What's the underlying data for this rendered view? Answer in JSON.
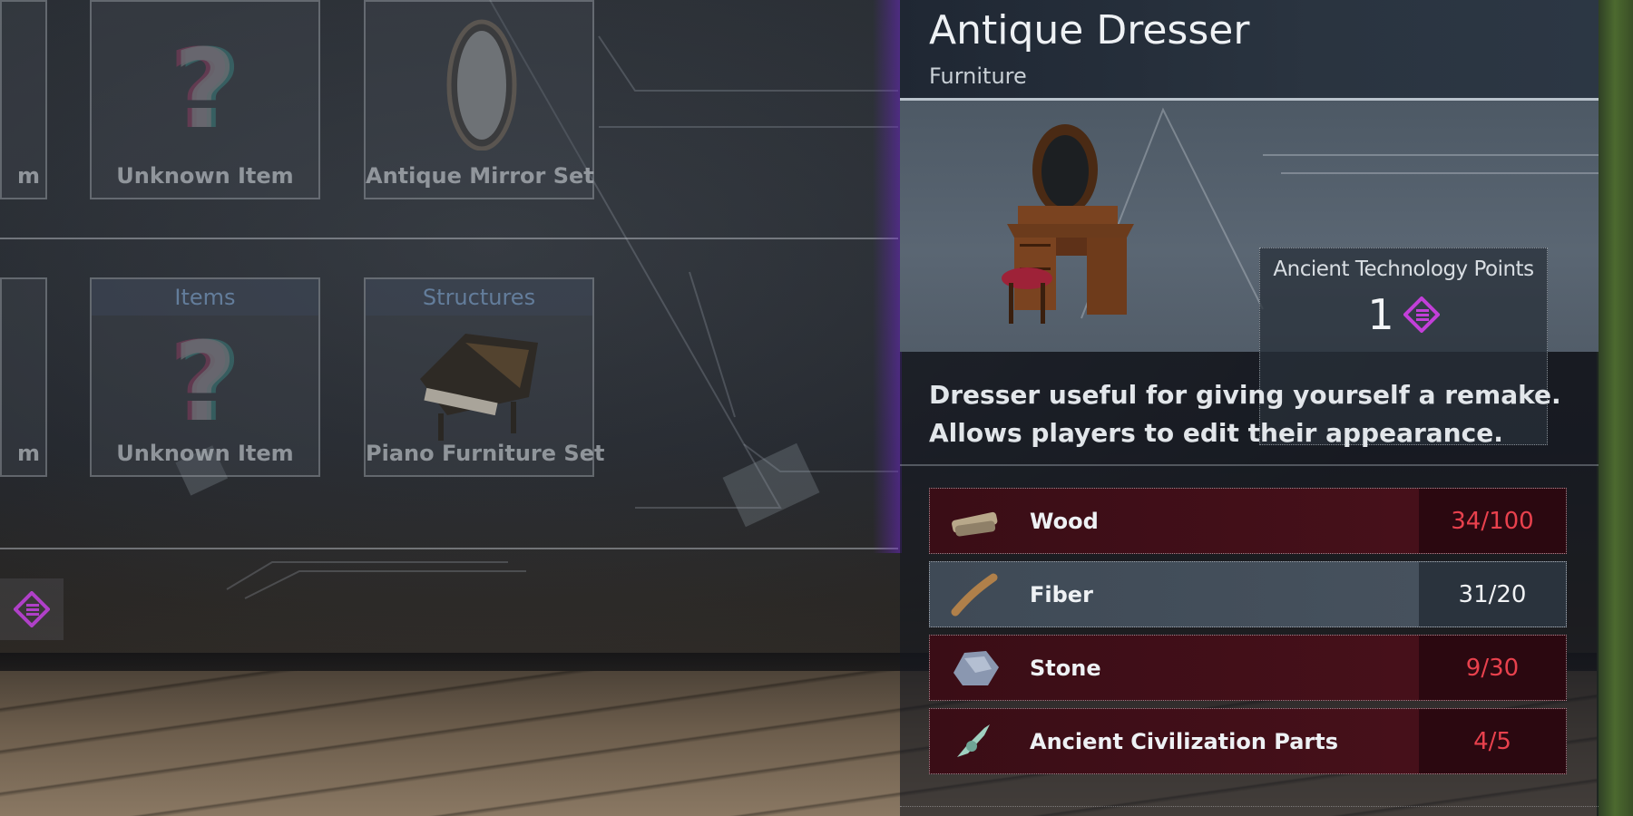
{
  "left_grid": {
    "row1": [
      {
        "label": "m"
      },
      {
        "label": "Unknown Item"
      },
      {
        "label": "Antique Mirror Set"
      }
    ],
    "row2": [
      {
        "label": "m"
      },
      {
        "header": "Items",
        "label": "Unknown Item"
      },
      {
        "header": "Structures",
        "label": "Piano Furniture Set"
      }
    ]
  },
  "detail": {
    "title": "Antique Dresser",
    "category": "Furniture",
    "atp_label": "Ancient Technology Points",
    "atp_value": "1",
    "description_line1": "Dresser useful for giving yourself a remake.",
    "description_line2": "Allows players to edit their appearance.",
    "materials": [
      {
        "name": "Wood",
        "count": "34/100",
        "icon": "wood-icon",
        "sufficient": false
      },
      {
        "name": "Fiber",
        "count": "31/20",
        "icon": "fiber-icon",
        "sufficient": true
      },
      {
        "name": "Stone",
        "count": "9/30",
        "icon": "stone-icon",
        "sufficient": false
      },
      {
        "name": "Ancient Civilization Parts",
        "count": "4/5",
        "icon": "ancient-parts-icon",
        "sufficient": false
      }
    ]
  },
  "colors": {
    "insufficient": "#e8414d",
    "sufficient": "#f0f2f4",
    "ancient_point": "#c23fd8",
    "panel_glow": "#6e28c8"
  }
}
